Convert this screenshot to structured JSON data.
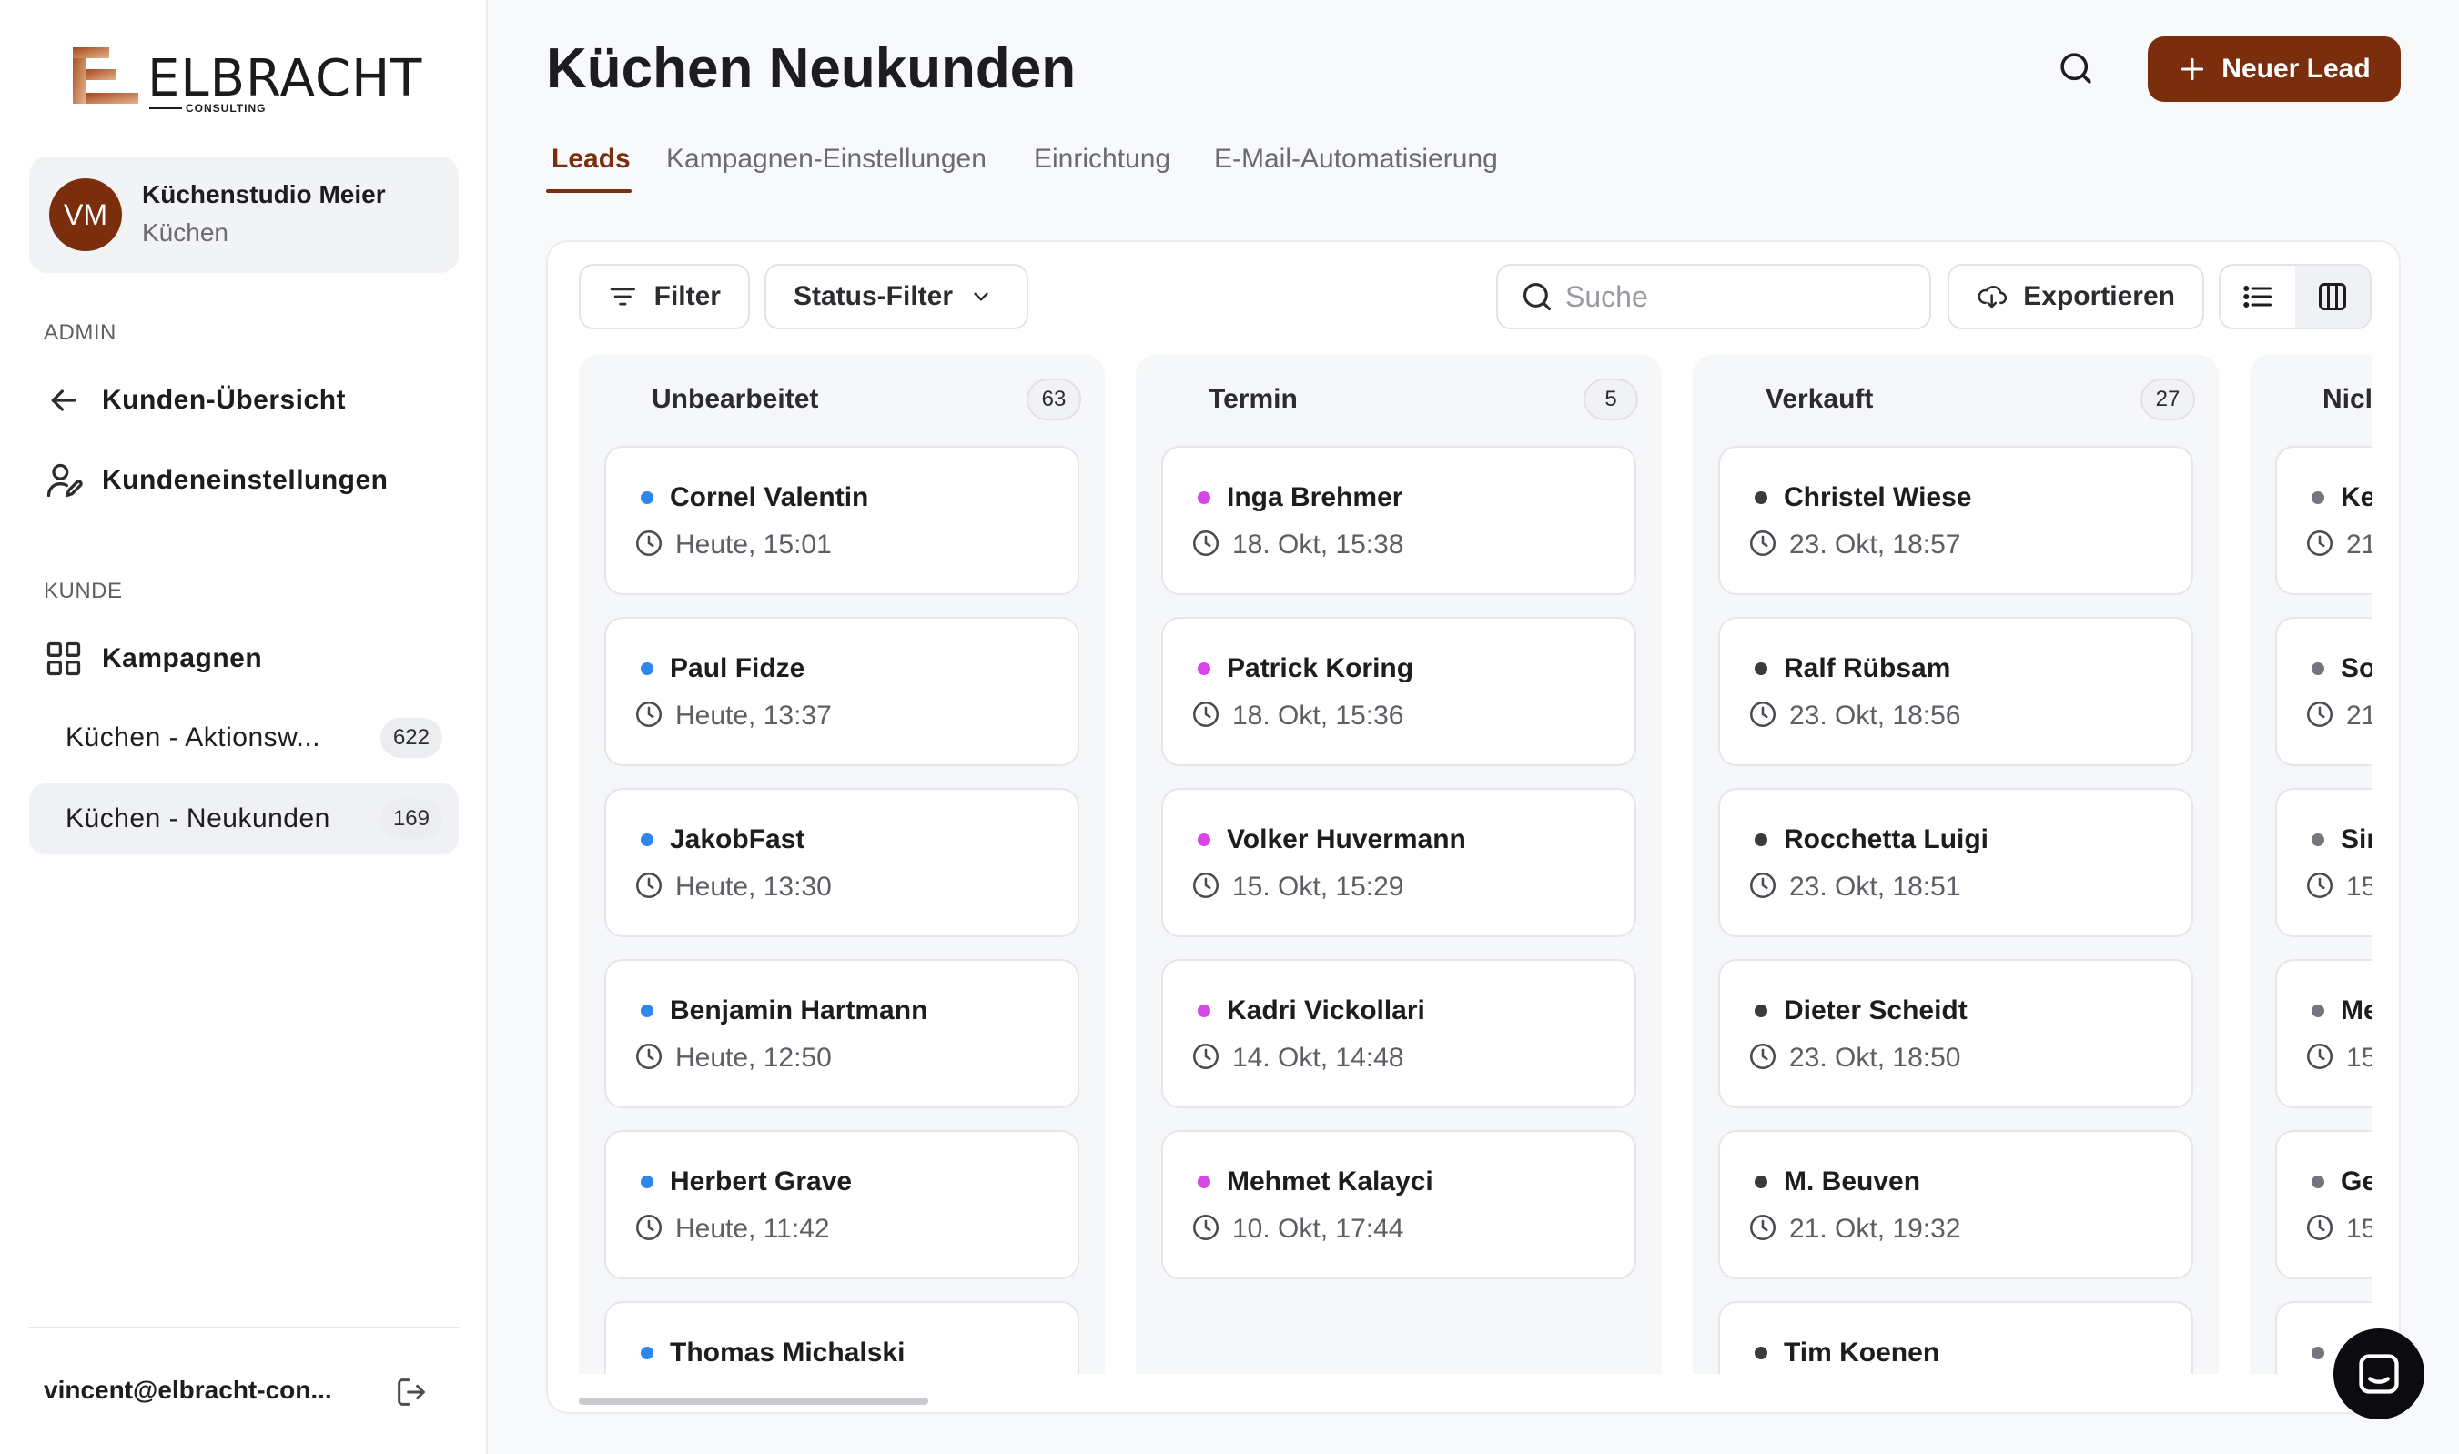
{
  "brand": {
    "name": "ELBRACHT",
    "sub": "CONSULTING",
    "accent": "#7a2e0e"
  },
  "account": {
    "initials": "VM",
    "name": "Küchenstudio Meier",
    "category": "Küchen"
  },
  "sidebar": {
    "admin_label": "ADMIN",
    "admin_items": [
      {
        "label": "Kunden-Übersicht",
        "icon": "arrow-left-icon"
      },
      {
        "label": "Kundeneinstellungen",
        "icon": "user-settings-icon"
      }
    ],
    "kunde_label": "KUNDE",
    "kampagnen_label": "Kampagnen",
    "campaigns": [
      {
        "label": "Küchen - Aktionsw...",
        "count": "622"
      },
      {
        "label": "Küchen - Neukunden",
        "count": "169"
      }
    ],
    "user_email": "vincent@elbracht-con..."
  },
  "header": {
    "title": "Küchen Neukunden",
    "new_lead_label": "Neuer Lead"
  },
  "tabs": [
    {
      "label": "Leads"
    },
    {
      "label": "Kampagnen-Einstellungen"
    },
    {
      "label": "Einrichtung"
    },
    {
      "label": "E-Mail-Automatisierung"
    }
  ],
  "toolbar": {
    "filter_label": "Filter",
    "status_filter_label": "Status-Filter",
    "search_placeholder": "Suche",
    "export_label": "Exportieren"
  },
  "columns": [
    {
      "title": "Unbearbeitet",
      "count": "63",
      "dot_color": "#2f86eb",
      "leads": [
        {
          "name": "Cornel Valentin",
          "time": "Heute, 15:01"
        },
        {
          "name": "Paul Fidze",
          "time": "Heute, 13:37"
        },
        {
          "name": "JakobFast",
          "time": "Heute, 13:30"
        },
        {
          "name": "Benjamin Hartmann",
          "time": "Heute, 12:50"
        },
        {
          "name": "Herbert Grave",
          "time": "Heute, 11:42"
        },
        {
          "name": "Thomas Michalski",
          "time": ""
        }
      ]
    },
    {
      "title": "Termin",
      "count": "5",
      "dot_color": "#d946e8",
      "leads": [
        {
          "name": "Inga Brehmer",
          "time": "18. Okt, 15:38"
        },
        {
          "name": "Patrick Koring",
          "time": "18. Okt, 15:36"
        },
        {
          "name": "Volker Huvermann",
          "time": "15. Okt, 15:29"
        },
        {
          "name": "Kadri Vickollari",
          "time": "14. Okt, 14:48"
        },
        {
          "name": "Mehmet Kalayci",
          "time": "10. Okt, 17:44"
        }
      ]
    },
    {
      "title": "Verkauft",
      "count": "27",
      "dot_color": "#3a3a3f",
      "leads": [
        {
          "name": "Christel Wiese",
          "time": "23. Okt, 18:57"
        },
        {
          "name": "Ralf Rübsam",
          "time": "23. Okt, 18:56"
        },
        {
          "name": "Rocchetta Luigi",
          "time": "23. Okt, 18:51"
        },
        {
          "name": "Dieter Scheidt",
          "time": "23. Okt, 18:50"
        },
        {
          "name": "M. Beuven",
          "time": "21. Okt, 19:32"
        },
        {
          "name": "Tim Koenen",
          "time": ""
        }
      ]
    },
    {
      "title": "Nicl",
      "count": "",
      "dot_color": "#75757c",
      "leads": [
        {
          "name": "Ke",
          "time": "21"
        },
        {
          "name": "So",
          "time": "21"
        },
        {
          "name": "Sir",
          "time": "15"
        },
        {
          "name": "Me",
          "time": "15"
        },
        {
          "name": "Ge",
          "time": "15"
        },
        {
          "name": "",
          "time": ""
        }
      ]
    }
  ]
}
